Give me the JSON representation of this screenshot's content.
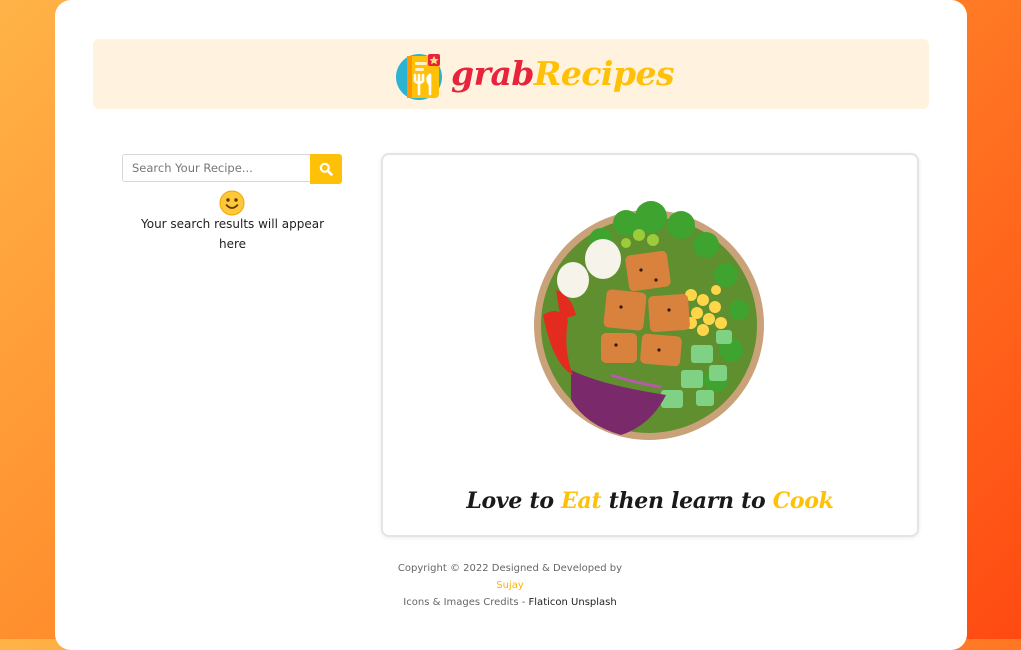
{
  "brand": {
    "part1": "grab",
    "part2": "Recipes",
    "logo_icon": "recipe-book-icon"
  },
  "search": {
    "placeholder": "Search Your Recipe...",
    "value": "",
    "button_icon": "search-icon",
    "empty_emoji": "smiley-icon",
    "empty_message": "Your search results will appear here"
  },
  "hero": {
    "image": "salad-bowl-image",
    "tagline": {
      "t1": "Love to ",
      "t2": "Eat",
      "t3": " then learn to ",
      "t4": "Cook"
    }
  },
  "footer": {
    "copyright": "Copyright © 2022 Designed & Developed by ",
    "author": "Sujay",
    "credits_label": "Icons & Images Credits - ",
    "credits_flaticon": "Flaticon",
    "credits_unsplash": "Unsplash"
  },
  "colors": {
    "accent": "#ffc107",
    "brand_red": "#e8243c",
    "header_bg": "#fff3df"
  }
}
